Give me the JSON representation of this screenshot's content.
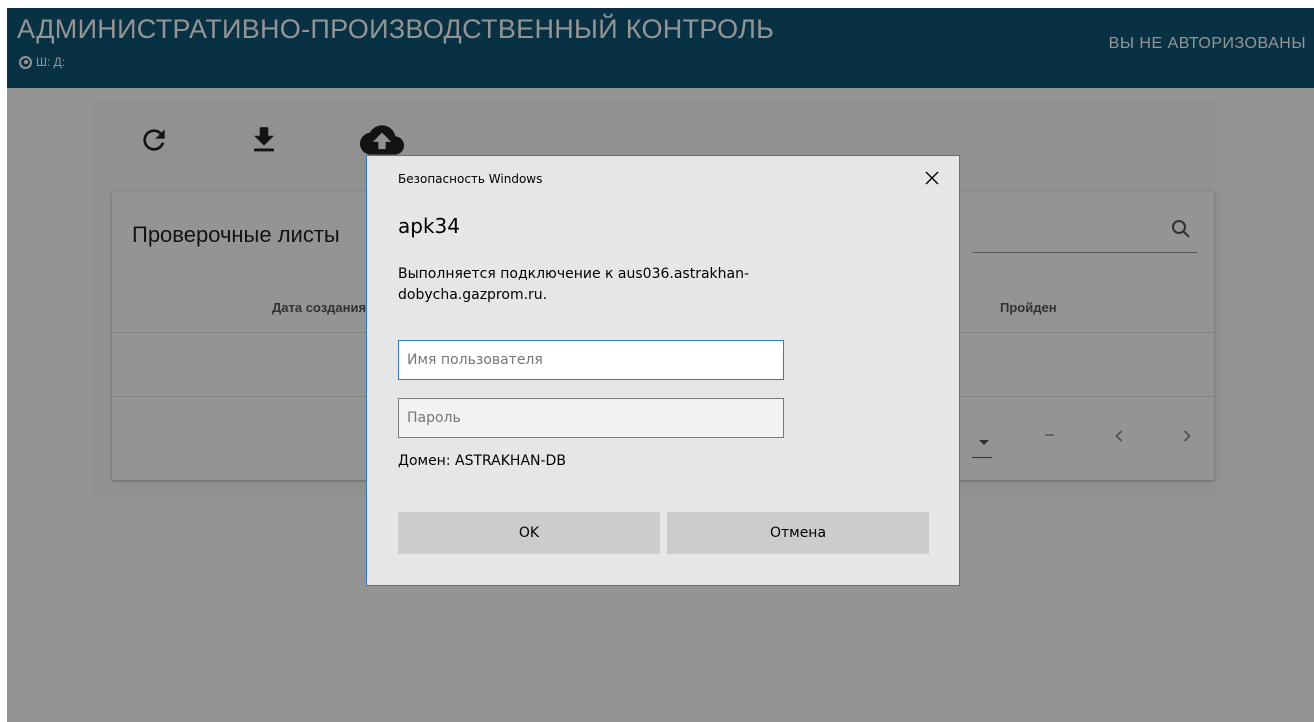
{
  "app": {
    "title": "АДМИНИСТРАТИВНО-ПРОИЗВОДСТВЕННЫЙ КОНТРОЛЬ",
    "location_text": "Ш: Д:",
    "auth_status": "ВЫ НЕ АВТОРИЗОВАНЫ"
  },
  "toolbar": {
    "buttons": [
      {
        "icon": "refresh-icon"
      },
      {
        "icon": "download-icon"
      },
      {
        "icon": "cloud-upload-icon"
      }
    ]
  },
  "card": {
    "title": "Проверочные листы",
    "search_icon": "search-icon",
    "columns": [
      "Дата создания",
      "Пройден"
    ],
    "pagination": {
      "range": "–",
      "prev_icon": "chevron-left-icon",
      "next_icon": "chevron-right-icon"
    }
  },
  "dialog": {
    "caption": "Безопасность Windows",
    "title": "apk34",
    "message": "Выполняется подключение к aus036.astrakhan-dobycha.gazprom.ru.",
    "username_placeholder": "Имя пользователя",
    "password_placeholder": "Пароль",
    "domain": "Домен: ASTRAKHAN-DB",
    "ok_label": "OK",
    "cancel_label": "Отмена"
  },
  "colors": {
    "header_bg": "#0e5576",
    "dialog_bg": "#e6e6e6",
    "dialog_border": "#2d7ad4",
    "button_bg": "#cccccc"
  }
}
